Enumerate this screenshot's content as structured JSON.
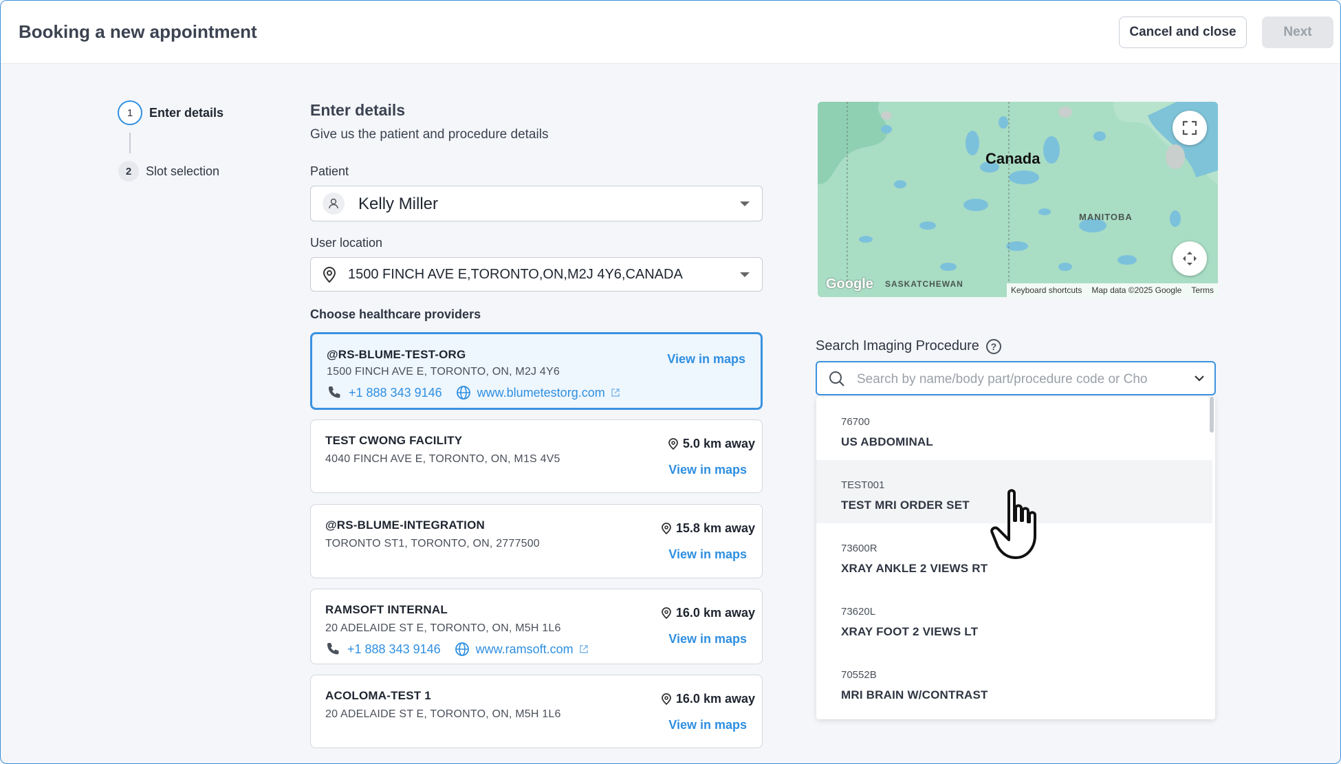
{
  "header": {
    "title": "Booking a new appointment",
    "cancel_label": "Cancel and close",
    "next_label": "Next"
  },
  "stepper": [
    {
      "number": "1",
      "label": "Enter details"
    },
    {
      "number": "2",
      "label": "Slot selection"
    }
  ],
  "form": {
    "title": "Enter details",
    "subtitle": "Give us the patient and procedure details",
    "patient_label": "Patient",
    "patient_value": "Kelly Miller",
    "location_label": "User location",
    "location_value": "1500 FINCH AVE E,TORONTO,ON,M2J 4Y6,CANADA",
    "providers_label": "Choose healthcare providers"
  },
  "providers": [
    {
      "name": "@RS-BLUME-TEST-ORG",
      "address": "1500 FINCH AVE E, TORONTO, ON, M2J 4Y6",
      "phone": "+1 888 343 9146",
      "website": "www.blumetestorg.com",
      "view_maps": "View in maps"
    },
    {
      "name": "TEST CWONG FACILITY",
      "address": "4040 FINCH AVE E, TORONTO, ON, M1S 4V5",
      "distance": "5.0 km away",
      "view_maps": "View in maps"
    },
    {
      "name": "@RS-BLUME-INTEGRATION",
      "address": "TORONTO ST1, TORONTO, ON, 2777500",
      "distance": "15.8 km away",
      "view_maps": "View in maps"
    },
    {
      "name": "RAMSOFT INTERNAL",
      "address": "20 ADELAIDE ST E, TORONTO, ON, M5H 1L6",
      "distance": "16.0 km away",
      "phone": "+1 888 343 9146",
      "website": "www.ramsoft.com",
      "view_maps": "View in maps"
    },
    {
      "name": "ACOLOMA-TEST 1",
      "address": "20 ADELAIDE ST E, TORONTO, ON, M5H 1L6",
      "distance": "16.0 km away",
      "view_maps": "View in maps"
    }
  ],
  "map": {
    "country_label": "Canada",
    "region1": "MANITOBA",
    "region2": "SASKATCHEWAN",
    "logo": "Google",
    "footer_shortcuts": "Keyboard shortcuts",
    "footer_data": "Map data ©2025 Google",
    "footer_terms": "Terms"
  },
  "search": {
    "label": "Search Imaging Procedure",
    "placeholder": "Search by name/body part/procedure code or Cho"
  },
  "procedures": [
    {
      "code": "76700",
      "name": "US ABDOMINAL"
    },
    {
      "code": "TEST001",
      "name": "TEST MRI ORDER SET"
    },
    {
      "code": "73600R",
      "name": "XRAY ANKLE 2 VIEWS RT"
    },
    {
      "code": "73620L",
      "name": "XRAY FOOT 2 VIEWS LT"
    },
    {
      "code": "70552B",
      "name": "MRI BRAIN W/CONTRAST"
    }
  ],
  "colors": {
    "accent": "#2f8fe0",
    "selected_bg": "#eef6fe",
    "map_land": "#a7dcc1",
    "map_water": "#7cc1dc"
  }
}
